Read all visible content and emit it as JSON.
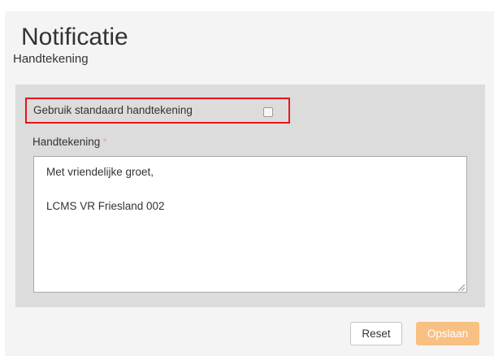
{
  "page": {
    "title": "Notificatie",
    "subtitle": "Handtekening"
  },
  "form": {
    "use_default_signature": {
      "label": "Gebruik standaard handtekening",
      "checked": false
    },
    "signature": {
      "label": "Handtekening",
      "required_marker": "*",
      "value": "Met vriendelijke groet,\n\nLCMS VR Friesland 002"
    }
  },
  "actions": {
    "reset_label": "Reset",
    "save_label": "Opslaan"
  },
  "colors": {
    "highlight_border": "#e8141c",
    "save_button": "#f9c083",
    "panel_background": "#dcdcdc",
    "required_marker": "#f0a5a0"
  }
}
